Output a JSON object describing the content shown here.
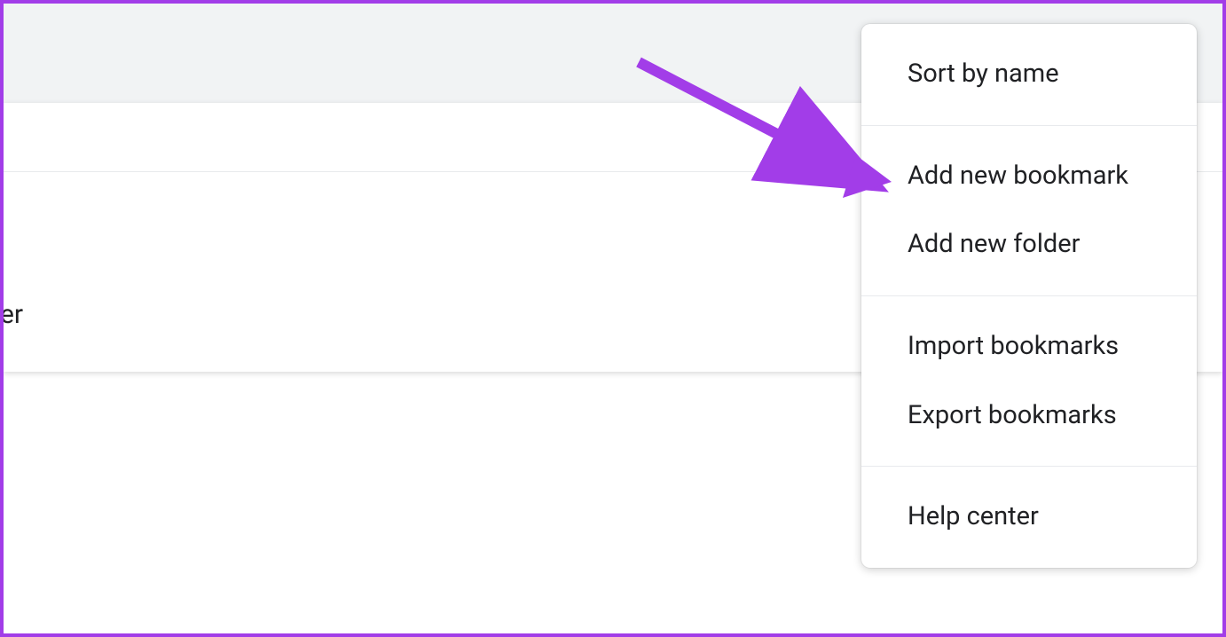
{
  "partial_text": "er",
  "menu": {
    "section1": {
      "sort_by_name": "Sort by name"
    },
    "section2": {
      "add_new_bookmark": "Add new bookmark",
      "add_new_folder": "Add new folder"
    },
    "section3": {
      "import_bookmarks": "Import bookmarks",
      "export_bookmarks": "Export bookmarks"
    },
    "section4": {
      "help_center": "Help center"
    }
  }
}
